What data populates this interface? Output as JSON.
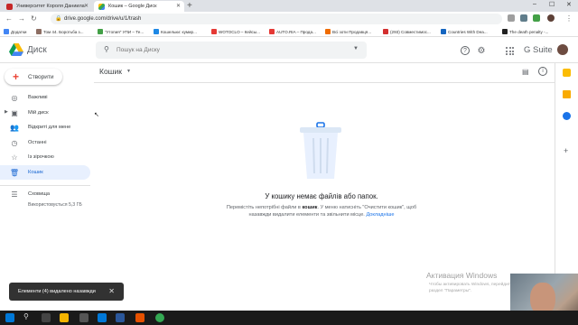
{
  "browser": {
    "tabs": [
      {
        "label": "Университет Короля Даниила"
      },
      {
        "label": "Кошик – Google Диск"
      }
    ],
    "new_tab": "+",
    "window_controls": {
      "minimize": "–",
      "maximize": "☐",
      "close": "✕"
    },
    "address": "drive.google.com/drive/u/1/trash",
    "bookmarks": [
      {
        "label": "Додатки",
        "color": "#4285f4"
      },
      {
        "label": "Том 44. Боротьба з...",
        "color": "#8d6e63"
      },
      {
        "label": "\"Утопия\" УПИ – Те...",
        "color": "#43a047"
      },
      {
        "label": "Кошельки: кумир...",
        "color": "#1e88e5"
      },
      {
        "label": "WOTOCLO – Кейсы...",
        "color": "#e53935"
      },
      {
        "label": "AUTO.RIA – Прода...",
        "color": "#e53935"
      },
      {
        "label": "Всі зоти Продавця...",
        "color": "#ef6c00"
      },
      {
        "label": "(293) Совместимос...",
        "color": "#d32f2f"
      },
      {
        "label": "Countries With Dea...",
        "color": "#1565c0"
      },
      {
        "label": "The death penalty -...",
        "color": "#212121"
      }
    ]
  },
  "header": {
    "app_name": "Диск",
    "search_placeholder": "Пошук на Диску",
    "gsuite": "G Suite",
    "help_icon": "help-icon",
    "settings_icon": "settings-icon"
  },
  "sidebar": {
    "create_label": "Створити",
    "items": [
      {
        "label": "Важливі",
        "icon": "priority-icon"
      },
      {
        "label": "Мій диск",
        "icon": "my-drive-icon"
      },
      {
        "label": "Відкриті для мене",
        "icon": "shared-icon"
      },
      {
        "label": "Останні",
        "icon": "recent-icon"
      },
      {
        "label": "Із зірочкою",
        "icon": "star-icon"
      },
      {
        "label": "Кошик",
        "icon": "trash-icon"
      },
      {
        "label": "Сховища",
        "icon": "storage-icon"
      }
    ],
    "storage_used": "Використовується 5,3 ГБ"
  },
  "main": {
    "breadcrumb": "Кошик",
    "empty_title": "У кошику немає файлів або папок.",
    "empty_desc_1": "Перемістіть непотрібні файли в ",
    "empty_desc_bold": "кошик",
    "empty_desc_2": ". У меню натисніть \"Очистити кошик\", щоб назавжди видалити елементи та звільнити місце.",
    "empty_link": "Докладніше"
  },
  "toast": {
    "text": "Елементи (4) видалено назавжди",
    "close": "✕"
  },
  "watermark": {
    "title": "Активация Windows",
    "subtitle": "Чтобы активировать Windows, перейдите в раздел \"Параметры\"."
  },
  "colors": {
    "active_bg": "#e8f0fe",
    "active_text": "#1967d2",
    "link": "#1a73e8",
    "toast_bg": "#323232"
  }
}
